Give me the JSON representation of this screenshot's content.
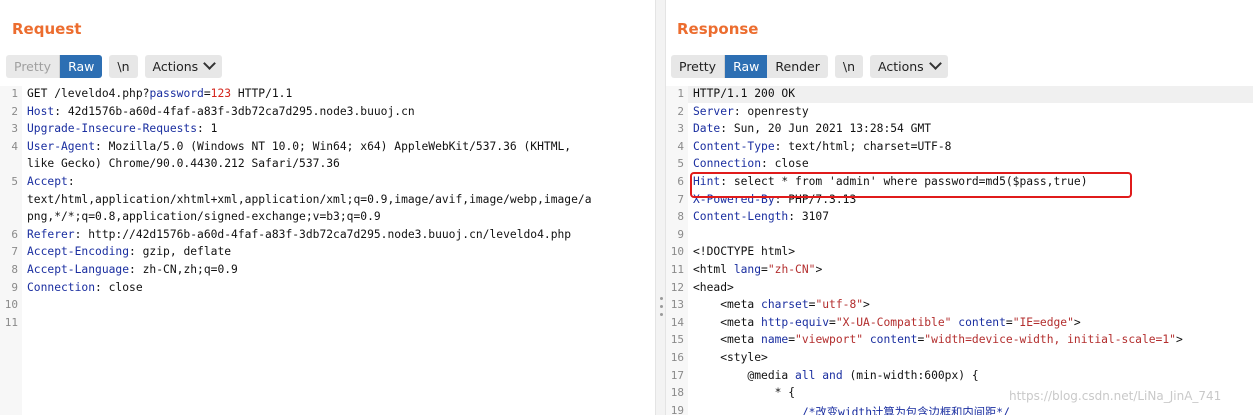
{
  "request": {
    "title": "Request",
    "buttons": {
      "pretty": "Pretty",
      "raw": "Raw",
      "newline": "\\n",
      "actions": "Actions"
    },
    "line_numbers": [
      "1",
      "2",
      "3",
      "4",
      "",
      "5",
      "",
      "",
      "6",
      "7",
      "8",
      "9",
      "10",
      "11"
    ],
    "lines": [
      {
        "segments": [
          [
            "t",
            "GET /leveldo4.php?"
          ],
          [
            "k",
            "password"
          ],
          [
            "t",
            "="
          ],
          [
            "n",
            "123"
          ],
          [
            "t",
            " HTTP/1.1"
          ]
        ]
      },
      {
        "segments": [
          [
            "k",
            "Host"
          ],
          [
            "t",
            ": 42d1576b-a60d-4faf-a83f-3db72ca7d295.node3.buuoj.cn"
          ]
        ]
      },
      {
        "segments": [
          [
            "k",
            "Upgrade-Insecure-Requests"
          ],
          [
            "t",
            ": 1"
          ]
        ]
      },
      {
        "segments": [
          [
            "k",
            "User-Agent"
          ],
          [
            "t",
            ": Mozilla/5.0 (Windows NT 10.0; Win64; x64) AppleWebKit/537.36 (KHTML,"
          ]
        ]
      },
      {
        "segments": [
          [
            "t",
            "like Gecko) Chrome/90.0.4430.212 Safari/537.36"
          ]
        ]
      },
      {
        "segments": [
          [
            "k",
            "Accept"
          ],
          [
            "t",
            ":"
          ]
        ]
      },
      {
        "segments": [
          [
            "t",
            "text/html,application/xhtml+xml,application/xml;q=0.9,image/avif,image/webp,image/a"
          ]
        ]
      },
      {
        "segments": [
          [
            "t",
            "png,*/*;q=0.8,application/signed-exchange;v=b3;q=0.9"
          ]
        ]
      },
      {
        "segments": [
          [
            "k",
            "Referer"
          ],
          [
            "t",
            ": http://42d1576b-a60d-4faf-a83f-3db72ca7d295.node3.buuoj.cn/leveldo4.php"
          ]
        ]
      },
      {
        "segments": [
          [
            "k",
            "Accept-Encoding"
          ],
          [
            "t",
            ": gzip, deflate"
          ]
        ]
      },
      {
        "segments": [
          [
            "k",
            "Accept-Language"
          ],
          [
            "t",
            ": zh-CN,zh;q=0.9"
          ]
        ]
      },
      {
        "segments": [
          [
            "k",
            "Connection"
          ],
          [
            "t",
            ": close"
          ]
        ]
      },
      {
        "segments": []
      },
      {
        "segments": []
      }
    ]
  },
  "response": {
    "title": "Response",
    "buttons": {
      "pretty": "Pretty",
      "raw": "Raw",
      "render": "Render",
      "newline": "\\n",
      "actions": "Actions"
    },
    "line_numbers": [
      "1",
      "2",
      "3",
      "4",
      "5",
      "6",
      "7",
      "8",
      "9",
      "10",
      "11",
      "12",
      "13",
      "14",
      "15",
      "16",
      "17",
      "18",
      "19"
    ],
    "lines": [
      {
        "segments": [
          [
            "t",
            "HTTP/1.1 200 OK"
          ]
        ]
      },
      {
        "segments": [
          [
            "k",
            "Server"
          ],
          [
            "t",
            ": openresty"
          ]
        ]
      },
      {
        "segments": [
          [
            "k",
            "Date"
          ],
          [
            "t",
            ": Sun, 20 Jun 2021 13:28:54 GMT"
          ]
        ]
      },
      {
        "segments": [
          [
            "k",
            "Content-Type"
          ],
          [
            "t",
            ": text/html; charset=UTF-8"
          ]
        ]
      },
      {
        "segments": [
          [
            "k",
            "Connection"
          ],
          [
            "t",
            ": close"
          ]
        ]
      },
      {
        "segments": [
          [
            "k",
            "Hint"
          ],
          [
            "t",
            ": select * from 'admin' where password=md5($pass,true)"
          ]
        ]
      },
      {
        "segments": [
          [
            "k",
            "X-Powered-By"
          ],
          [
            "t",
            ": PHP/7.3.13"
          ]
        ]
      },
      {
        "segments": [
          [
            "k",
            "Content-Length"
          ],
          [
            "t",
            ": 3107"
          ]
        ]
      },
      {
        "segments": []
      },
      {
        "segments": [
          [
            "t",
            "<!DOCTYPE html>"
          ]
        ]
      },
      {
        "segments": [
          [
            "t",
            "<html "
          ],
          [
            "attr",
            "lang"
          ],
          [
            "t",
            "="
          ],
          [
            "a",
            "\"zh-CN\""
          ],
          [
            "t",
            ">"
          ]
        ]
      },
      {
        "segments": [
          [
            "t",
            "<head>"
          ]
        ]
      },
      {
        "segments": [
          [
            "t",
            "    <meta "
          ],
          [
            "attr",
            "charset"
          ],
          [
            "t",
            "="
          ],
          [
            "a",
            "\"utf-8\""
          ],
          [
            "t",
            ">"
          ]
        ]
      },
      {
        "segments": [
          [
            "t",
            "    <meta "
          ],
          [
            "attr",
            "http-equiv"
          ],
          [
            "t",
            "="
          ],
          [
            "a",
            "\"X-UA-Compatible\""
          ],
          [
            "t",
            " "
          ],
          [
            "attr",
            "content"
          ],
          [
            "t",
            "="
          ],
          [
            "a",
            "\"IE=edge\""
          ],
          [
            "t",
            ">"
          ]
        ]
      },
      {
        "segments": [
          [
            "t",
            "    <meta "
          ],
          [
            "attr",
            "name"
          ],
          [
            "t",
            "="
          ],
          [
            "a",
            "\"viewport\""
          ],
          [
            "t",
            " "
          ],
          [
            "attr",
            "content"
          ],
          [
            "t",
            "="
          ],
          [
            "a",
            "\"width=device-width, initial-scale=1\""
          ],
          [
            "t",
            ">"
          ]
        ]
      },
      {
        "segments": [
          [
            "t",
            "    <style>"
          ]
        ]
      },
      {
        "segments": [
          [
            "t",
            "        @media "
          ],
          [
            "k",
            "all"
          ],
          [
            "t",
            " "
          ],
          [
            "k",
            "and"
          ],
          [
            "t",
            " (min-width:600px) {"
          ]
        ]
      },
      {
        "segments": [
          [
            "t",
            "            * {"
          ]
        ]
      },
      {
        "segments": [
          [
            "t",
            "                "
          ],
          [
            "k",
            "/*改变width计算为包含边框和内间距*/"
          ]
        ]
      }
    ],
    "watermark": "https://blog.csdn.net/LiNa_JinA_741"
  }
}
